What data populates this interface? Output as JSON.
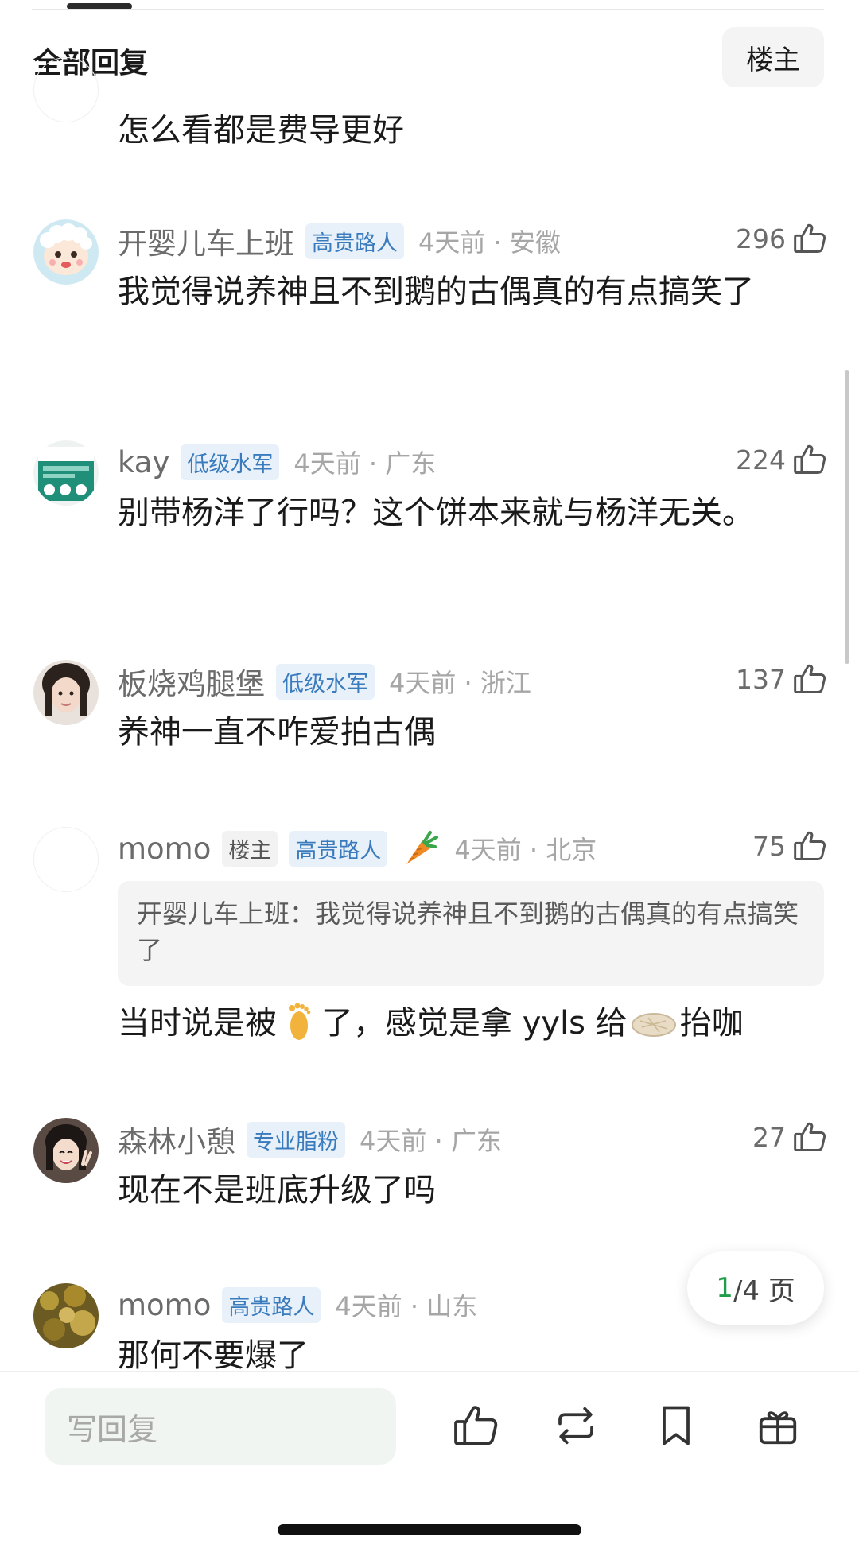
{
  "header": {
    "title": "全部回复",
    "filter_label": "楼主"
  },
  "partial_comment": {
    "text": "怎么看都是费导更好"
  },
  "comments": [
    {
      "username": "开婴儿车上班",
      "badge": "高贵路人",
      "time_location": "4天前 · 安徽",
      "likes": "296",
      "text": "我觉得说养神且不到鹅的古偶真的有点搞笑了"
    },
    {
      "username": "kay",
      "badge": "低级水军",
      "time_location": "4天前 · 广东",
      "likes": "224",
      "text": "别带杨洋了行吗？这个饼本来就与杨洋无关。"
    },
    {
      "username": "板烧鸡腿堡",
      "badge": "低级水军",
      "time_location": "4天前 · 浙江",
      "likes": "137",
      "text": "养神一直不咋爱拍古偶"
    },
    {
      "username": "momo",
      "op_badge": "楼主",
      "badge": "高贵路人",
      "time_location": "4天前 · 北京",
      "likes": "75",
      "quote": "开婴儿车上班：我觉得说养神且不到鹅的古偶真的有点搞笑了",
      "text_part1": "当时说是被",
      "text_part2": "了，感觉是拿 yyls 给",
      "text_part3": "抬咖"
    },
    {
      "username": "森林小憩",
      "badge": "专业脂粉",
      "time_location": "4天前 · 广东",
      "likes": "27",
      "text": "现在不是班底升级了吗"
    },
    {
      "username": "momo",
      "badge": "高贵路人",
      "time_location": "4天前 · 山东",
      "text": "那何不要爆了"
    }
  ],
  "pagination": {
    "current": "1",
    "total_suffix": "/4 页"
  },
  "bottom_bar": {
    "reply_placeholder": "写回复"
  },
  "colors": {
    "accent_green": "#1e9e4a",
    "badge_blue": "#3a7bbd",
    "badge_bg": "#e8f1fa",
    "input_bg": "#f0f5f1"
  },
  "icons": [
    "thumb-up-icon",
    "carrot-icon",
    "foot-icon",
    "pancake-icon",
    "repost-icon",
    "bookmark-icon",
    "gift-icon"
  ]
}
